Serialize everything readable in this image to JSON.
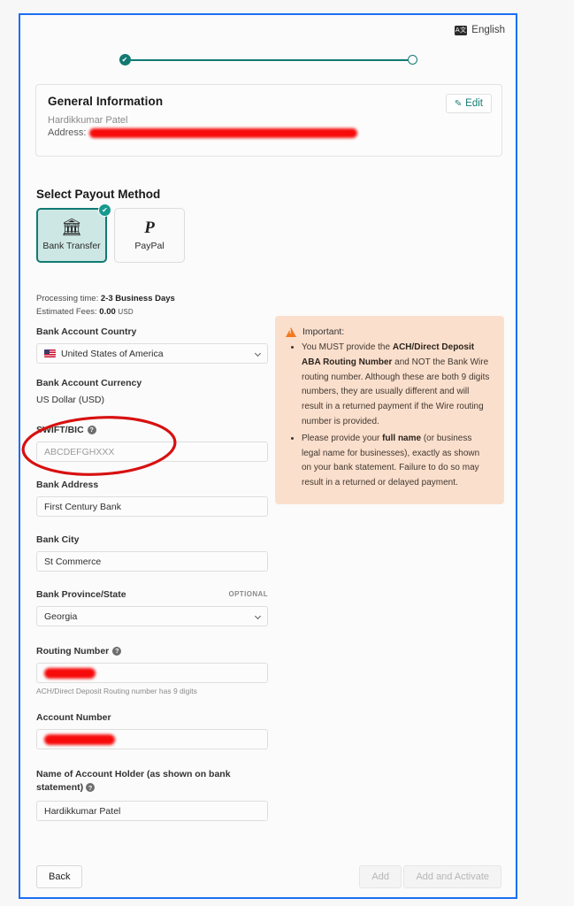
{
  "language": {
    "label": "English",
    "icon": "translate-icon",
    "icon_glyph": "A文"
  },
  "stepper": {
    "step1_state": "complete",
    "step2_state": "incomplete",
    "check_glyph": "✔"
  },
  "general_information": {
    "title": "General Information",
    "name": "Hardikkumar Patel",
    "address_label": "Address:",
    "address_value": "",
    "edit_label": "Edit",
    "edit_icon": "pencil-icon",
    "edit_icon_glyph": "✎"
  },
  "payout": {
    "section_title": "Select Payout Method",
    "methods": [
      {
        "label": "Bank Transfer",
        "icon": "bank-icon",
        "glyph": "🏛",
        "selected": true
      },
      {
        "label": "PayPal",
        "icon": "paypal-icon",
        "glyph": "P",
        "selected": false
      }
    ],
    "processing_time_label": "Processing time:",
    "processing_time_value": "2-3 Business Days",
    "estimated_fees_label": "Estimated Fees:",
    "estimated_fees_value": "0.00",
    "estimated_fees_currency": "USD"
  },
  "form": {
    "bank_account_country": {
      "label": "Bank Account Country",
      "value": "United States of America",
      "icon": "us-flag-icon"
    },
    "bank_account_currency": {
      "label": "Bank Account Currency",
      "value": "US Dollar (USD)"
    },
    "swift_bic": {
      "label": "SWIFT/BIC",
      "help": "?",
      "value": "",
      "placeholder": "ABCDEFGHXXX"
    },
    "bank_address": {
      "label": "Bank Address",
      "value": "First Century Bank"
    },
    "bank_city": {
      "label": "Bank City",
      "value": "St Commerce"
    },
    "bank_province_state": {
      "label": "Bank Province/State",
      "optional_tag": "OPTIONAL",
      "value": "Georgia"
    },
    "routing_number": {
      "label": "Routing Number",
      "help": "?",
      "value": "",
      "redacted": true,
      "help_text": "ACH/Direct Deposit Routing number has 9 digits"
    },
    "account_number": {
      "label": "Account Number",
      "value": "",
      "redacted": true
    },
    "account_holder": {
      "label": "Name of Account Holder (as shown on bank statement)",
      "help": "?",
      "value": "Hardikkumar Patel"
    }
  },
  "important": {
    "heading": "Important:",
    "icon": "warning-icon",
    "items": [
      {
        "part1": "You MUST provide the ",
        "bold1": "ACH/Direct Deposit ABA Routing Number",
        "part2": " and NOT the Bank Wire routing number. Although these are both 9 digits numbers, they are usually different and will result in a returned payment if the Wire routing number is provided."
      },
      {
        "part1": "Please provide your ",
        "bold1": "full name",
        "part2": " (or business legal name for businesses), exactly as shown on your bank statement. Failure to do so may result in a returned or delayed payment."
      }
    ]
  },
  "footer": {
    "back_label": "Back",
    "add_label": "Add",
    "add_activate_label": "Add and Activate"
  },
  "colors": {
    "accent_teal": "#117a73",
    "frame_blue": "#1b6ef3",
    "warning_bg": "#fbdfcd",
    "warning_icon": "#f07b22",
    "annotation_red": "#d81010",
    "redaction_red": "#f60a0a"
  }
}
